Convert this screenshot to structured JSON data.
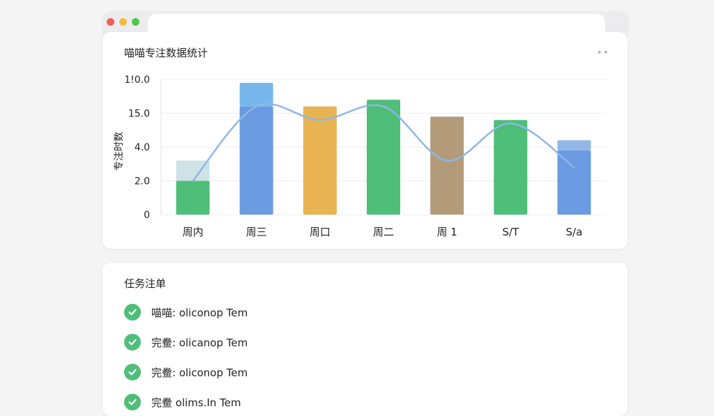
{
  "window": {
    "controls": [
      {
        "name": "close",
        "color": "#ef5f57"
      },
      {
        "name": "minimize",
        "color": "#f6bd3b"
      },
      {
        "name": "maximize",
        "color": "#4fc94a"
      }
    ]
  },
  "chart_card": {
    "title": "喵喵专注数据统计",
    "more_icon": "more-dots-icon"
  },
  "chart_data": {
    "type": "bar",
    "title": "喵喵专注数据统计",
    "ylabel": "专注时数",
    "xlabel": "",
    "categories": [
      "周内",
      "周三",
      "周口",
      "周二",
      "周 1",
      "S/T",
      "S/a"
    ],
    "values": [
      5.0,
      16.0,
      16.0,
      17.0,
      14.5,
      14.0,
      9.5
    ],
    "bar_colors": [
      "#4fbe79",
      "#6a9be0",
      "#e8b352",
      "#4fbe79",
      "#b39b7a",
      "#4fbe79",
      "#6a9be0"
    ],
    "upper_segment_values": [
      3.0,
      3.5,
      0,
      0,
      0,
      0,
      1.5
    ],
    "upper_segment_colors": [
      "#cfe3e7",
      "#77b7ee",
      "",
      "",
      "",
      "",
      "#92b6e6"
    ],
    "line_series": {
      "values": [
        5.0,
        16.0,
        14.0,
        16.0,
        8.0,
        13.5,
        7.0
      ],
      "color": "#8fb6e6"
    },
    "yaxis_ticks": [
      {
        "value": 0,
        "label": "0"
      },
      {
        "value": 5,
        "label": "2.0"
      },
      {
        "value": 10,
        "label": "4.0"
      },
      {
        "value": 15,
        "label": "15.0"
      },
      {
        "value": 20,
        "label": "1!0.0"
      }
    ],
    "ylim": [
      0,
      20
    ],
    "grid": true,
    "legend": "none"
  },
  "task_card": {
    "title": "任务注单",
    "tasks": [
      {
        "label": "喵喵: oliconop Tem",
        "done": true
      },
      {
        "label": "完鲞: olicanop Tem",
        "done": true
      },
      {
        "label": "完鲞: oliconop Tem",
        "done": true
      },
      {
        "label": "完鲞 olims.In Tem",
        "done": true
      }
    ],
    "check_color": "#4fbe79",
    "check_icon": "check-circle-icon"
  }
}
